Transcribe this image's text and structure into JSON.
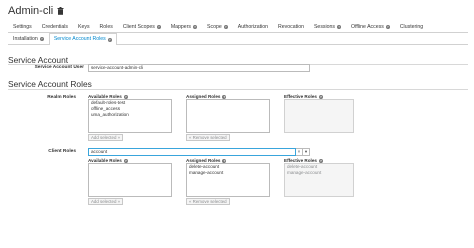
{
  "header": {
    "title": "Admin-cli",
    "delete_icon": "trash-icon"
  },
  "tabs_row1": [
    {
      "label": "Settings",
      "help": false,
      "active": false
    },
    {
      "label": "Credentials",
      "help": false,
      "active": false
    },
    {
      "label": "Keys",
      "help": false,
      "active": false
    },
    {
      "label": "Roles",
      "help": false,
      "active": false
    },
    {
      "label": "Client Scopes",
      "help": true,
      "active": false
    },
    {
      "label": "Mappers",
      "help": true,
      "active": false
    },
    {
      "label": "Scope",
      "help": true,
      "active": false
    },
    {
      "label": "Authorization",
      "help": false,
      "active": false
    },
    {
      "label": "Revocation",
      "help": false,
      "active": false
    },
    {
      "label": "Sessions",
      "help": true,
      "active": false
    },
    {
      "label": "Offline Access",
      "help": true,
      "active": false
    },
    {
      "label": "Clustering",
      "help": false,
      "active": false
    }
  ],
  "tabs_row2": [
    {
      "label": "Installation",
      "help": true,
      "active": false
    },
    {
      "label": "Service Account Roles",
      "help": true,
      "active": true
    }
  ],
  "service_account": {
    "section_title": "Service Account",
    "user_label": "Service Account User",
    "user_value": "service-account-admin-cli"
  },
  "roles": {
    "section_title": "Service Account Roles",
    "realm_label": "Realm Roles",
    "client_label": "Client Roles",
    "available_label": "Available Roles",
    "assigned_label": "Assigned Roles",
    "effective_label": "Effective Roles",
    "add_selected": "Add selected »",
    "remove_selected": "« Remove selected",
    "realm_available": [
      "default-roles-test",
      "offline_access",
      "uma_authorization"
    ],
    "realm_assigned": [],
    "realm_effective": [],
    "client_select_value": "account",
    "client_clear": "×",
    "client_caret": "▾",
    "client_available": [],
    "client_assigned": [
      "delete-account",
      "manage-account"
    ],
    "client_effective": [
      "delete-account",
      "manage-account"
    ]
  }
}
